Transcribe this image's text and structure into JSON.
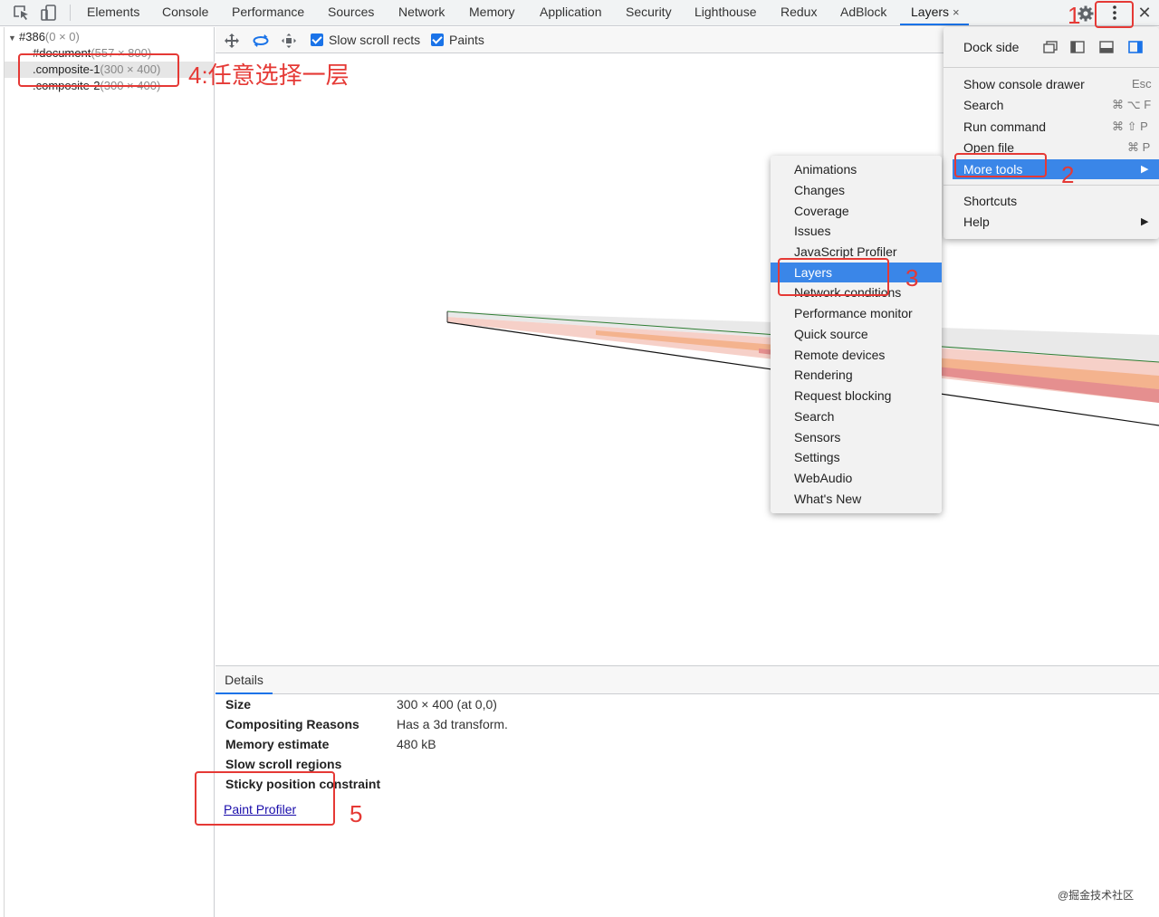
{
  "tabs": [
    "Elements",
    "Console",
    "Performance",
    "Sources",
    "Network",
    "Memory",
    "Application",
    "Security",
    "Lighthouse",
    "Redux",
    "AdBlock",
    "Layers"
  ],
  "active_tab_close": "×",
  "toolbar_icons": {
    "inspect": "inspect-element-icon",
    "device": "device-toggle-icon",
    "settings": "gear-icon",
    "more": "kebab-menu-icon",
    "close": "close-icon"
  },
  "layer_tree": [
    {
      "name": "#386",
      "size": "(0 × 0)"
    },
    {
      "name": "#document",
      "size": "(557 × 800)"
    },
    {
      "name": ".composite-1",
      "size": "(300 × 400)"
    },
    {
      "name": ".composite-2",
      "size": "(300 × 400)"
    }
  ],
  "layers_toolbar": {
    "icons": [
      "pan-mode-icon",
      "rotate-mode-icon",
      "reset-transform-icon"
    ],
    "slow_scroll_label": "Slow scroll rects",
    "paints_label": "Paints"
  },
  "details": {
    "tab_label": "Details",
    "rows": [
      {
        "label": "Size",
        "value": "300 × 400 (at 0,0)"
      },
      {
        "label": "Compositing Reasons",
        "value": "Has a 3d transform."
      },
      {
        "label": "Memory estimate",
        "value": "480 kB"
      },
      {
        "label": "Slow scroll regions",
        "value": ""
      },
      {
        "label": "Sticky position constraint",
        "value": ""
      }
    ],
    "paint_profiler_link": "Paint Profiler"
  },
  "main_menu": {
    "dock_side_label": "Dock side",
    "dock_icons": [
      "undock-icon",
      "dock-left-icon",
      "dock-bottom-icon",
      "dock-right-icon"
    ],
    "items": [
      {
        "label": "Show console drawer",
        "shortcut": "Esc"
      },
      {
        "label": "Search",
        "shortcut": "⌘ ⌥ F"
      },
      {
        "label": "Run command",
        "shortcut": "⌘ ⇧ P"
      },
      {
        "label": "Open file",
        "shortcut": "⌘ P"
      },
      {
        "label": "More tools",
        "shortcut": "▶"
      },
      {
        "label": "Shortcuts",
        "shortcut": ""
      },
      {
        "label": "Help",
        "shortcut": "▶"
      }
    ]
  },
  "more_tools_menu": [
    "Animations",
    "Changes",
    "Coverage",
    "Issues",
    "JavaScript Profiler",
    "Layers",
    "Network conditions",
    "Performance monitor",
    "Quick source",
    "Remote devices",
    "Rendering",
    "Request blocking",
    "Search",
    "Sensors",
    "Settings",
    "WebAudio",
    "What's New"
  ],
  "annotations": {
    "step1": "1",
    "step2": "2",
    "step3": "3",
    "step4": "4:任意选择一层",
    "step5": "5"
  },
  "watermark": "@掘金技术社区",
  "colors": {
    "accent": "#1a73e8",
    "highlight": "#3a86e8",
    "annotation": "#e53935"
  }
}
